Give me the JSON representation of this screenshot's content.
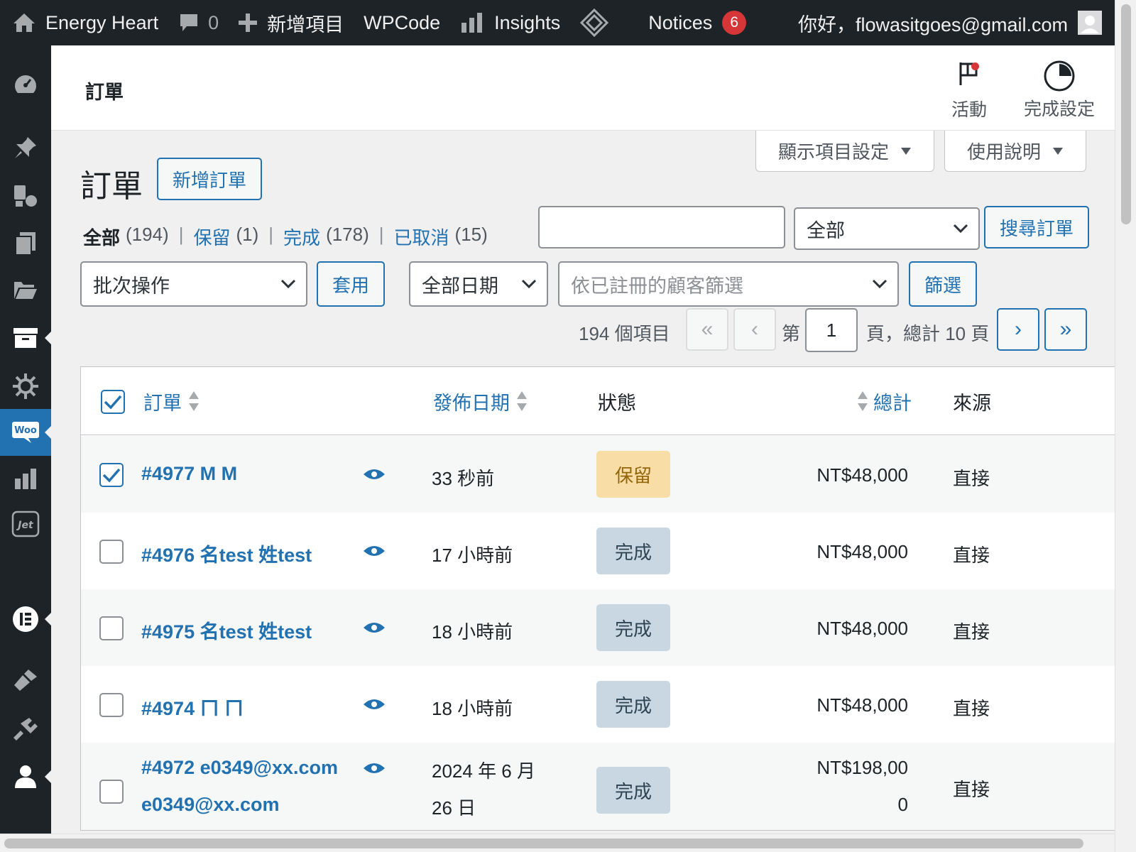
{
  "adminbar": {
    "site_name": "Energy Heart",
    "comments_count": "0",
    "new_label": "新增項目",
    "wpcode_label": "WPCode",
    "insights_label": "Insights",
    "notices_label": "Notices",
    "notices_count": "6",
    "greeting": "你好，flowasitgoes@gmail.com"
  },
  "header": {
    "title": "訂單",
    "activity_label": "活動",
    "setup_label": "完成設定"
  },
  "screen_options": {
    "display_label": "顯示項目設定",
    "help_label": "使用說明"
  },
  "page": {
    "title": "訂單",
    "new_order_label": "新增訂單"
  },
  "filters": {
    "views": [
      {
        "label": "全部",
        "count": "(194)"
      },
      {
        "label": "保留",
        "count": "(1)"
      },
      {
        "label": "完成",
        "count": "(178)"
      },
      {
        "label": "已取消",
        "count": "(15)"
      }
    ],
    "search_type_value": "全部",
    "search_button": "搜尋訂單",
    "bulk_action_value": "批次操作",
    "apply_button": "套用",
    "date_value": "全部日期",
    "customer_placeholder": "依已註冊的顧客篩選",
    "filter_button": "篩選"
  },
  "pagination": {
    "items_count": "194 個項目",
    "first": "«",
    "prev": "‹",
    "page_prefix": "第",
    "current_page": "1",
    "page_suffix": "頁，總計 10 頁",
    "next": "›",
    "last": "»"
  },
  "table": {
    "columns": {
      "order": "訂單",
      "date": "發佈日期",
      "status": "狀態",
      "total": "總計",
      "origin": "來源"
    },
    "rows": [
      {
        "order": "#4977 M M",
        "date": "33 秒前",
        "status": "保留",
        "total": "NT$48,000",
        "origin": "直接"
      },
      {
        "order": "#4976 名test 姓test",
        "date": "17 小時前",
        "status": "完成",
        "total": "NT$48,000",
        "origin": "直接"
      },
      {
        "order": "#4975 名test 姓test",
        "date": "18 小時前",
        "status": "完成",
        "total": "NT$48,000",
        "origin": "直接"
      },
      {
        "order": "#4974 ㄇ ㄇ",
        "date": "18 小時前",
        "status": "完成",
        "total": "NT$48,000",
        "origin": "直接"
      },
      {
        "order_line1": "#4972 e0349@xx.com",
        "order_line2": "e0349@xx.com",
        "date_line1": "2024 年 6 月",
        "date_line2": "26 日",
        "status": "完成",
        "total_line1": "NT$198,00",
        "total_line2": "0",
        "origin": "直接"
      }
    ]
  },
  "colors": {
    "admin_dark": "#1d2327",
    "accent": "#2271b1",
    "on_hold_bg": "#f8dda7",
    "completed_bg": "#c8d7e1",
    "notice_badge": "#d63638"
  }
}
